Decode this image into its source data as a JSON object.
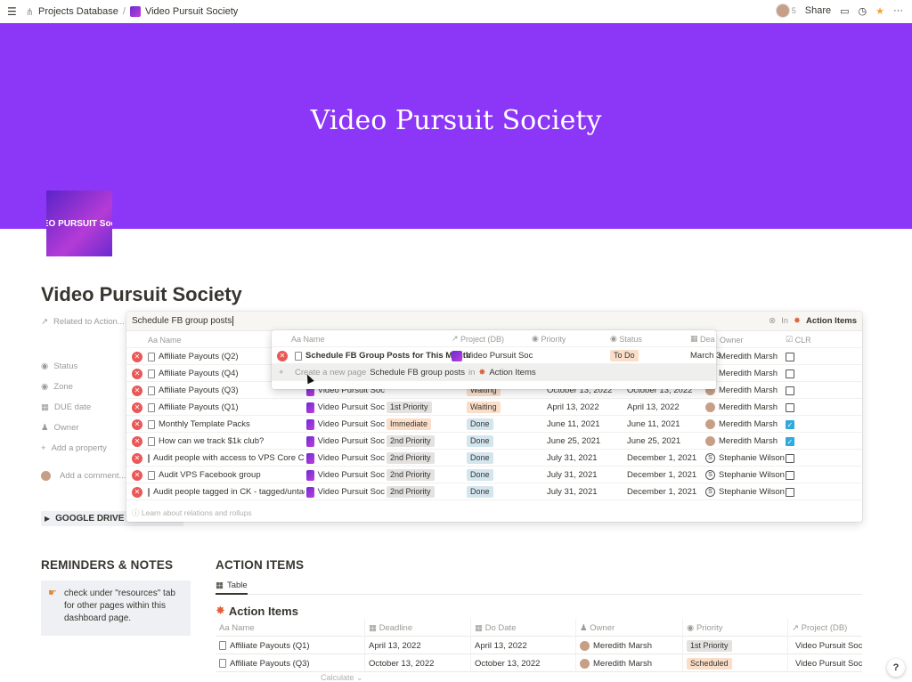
{
  "topbar": {
    "breadcrumb_parent": "Projects Database",
    "breadcrumb_sep": "/",
    "breadcrumb_current": "Video Pursuit Society",
    "share": "Share",
    "avatar_count": "5"
  },
  "cover": {
    "title": "Video Pursuit Society"
  },
  "logo": {
    "text": "EO PURSUIT Soc"
  },
  "page": {
    "title": "Video Pursuit Society"
  },
  "properties": [
    {
      "label": "Related to Action..."
    },
    {
      "label": "Status"
    },
    {
      "label": "Zone"
    },
    {
      "label": "DUE date"
    },
    {
      "label": "Owner"
    },
    {
      "label": "Add a property"
    },
    {
      "label": "Add a comment..."
    }
  ],
  "google_drive": "GOOGLE DRIVE",
  "relation": {
    "search_value": "Schedule FB group posts",
    "in_label": "In",
    "in_db": "Action Items",
    "headers": {
      "name": "Name",
      "project": "Project (DB)",
      "priority": "Priority",
      "status": "Status",
      "deadline": "Dea",
      "owner": "Owner",
      "clr": "CLR"
    },
    "footer": "Learn about relations and rollups",
    "rows": [
      {
        "name": "Affiliate Payouts (Q2)",
        "project": "Video Pursuit Soc",
        "priority": "",
        "status": "",
        "deadline": "",
        "do_date": "",
        "owner": "Meredith Marsh",
        "clr": false
      },
      {
        "name": "Affiliate Payouts (Q4)",
        "project": "Video Pursuit Soc",
        "priority": "",
        "status": "",
        "deadline": "",
        "do_date": "",
        "owner": "Meredith Marsh",
        "clr": false
      },
      {
        "name": "Affiliate Payouts (Q3)",
        "project": "Video Pursuit Soc",
        "priority": "",
        "status": "Waiting",
        "deadline": "October 13, 2022",
        "do_date": "October 13, 2022",
        "owner": "Meredith Marsh",
        "clr": false
      },
      {
        "name": "Affiliate Payouts (Q1)",
        "project": "Video Pursuit Soc",
        "priority": "1st Priority",
        "status": "Waiting",
        "deadline": "April 13, 2022",
        "do_date": "April 13, 2022",
        "owner": "Meredith Marsh",
        "clr": false
      },
      {
        "name": "Monthly Template Packs",
        "project": "Video Pursuit Soc",
        "priority": "Immediate",
        "status": "Done",
        "deadline": "June 11, 2021",
        "do_date": "June 11, 2021",
        "owner": "Meredith Marsh",
        "clr": true
      },
      {
        "name": "How can we track $1k club?",
        "project": "Video Pursuit Soc",
        "priority": "2nd Priority",
        "status": "Done",
        "deadline": "June 25, 2021",
        "do_date": "June 25, 2021",
        "owner": "Meredith Marsh",
        "clr": true
      },
      {
        "name": "Audit people with access to VPS Core Conte",
        "project": "Video Pursuit Soc",
        "priority": "2nd Priority",
        "status": "Done",
        "deadline": "July 31, 2021",
        "do_date": "December 1, 2021",
        "owner": "Stephanie Wilson",
        "clr": false
      },
      {
        "name": "Audit VPS Facebook group",
        "project": "Video Pursuit Soc",
        "priority": "2nd Priority",
        "status": "Done",
        "deadline": "July 31, 2021",
        "do_date": "December 1, 2021",
        "owner": "Stephanie Wilson",
        "clr": false
      },
      {
        "name": "Audit people tagged in CK - tagged/untagge",
        "project": "Video Pursuit Soc",
        "priority": "2nd Priority",
        "status": "Done",
        "deadline": "July 31, 2021",
        "do_date": "December 1, 2021",
        "owner": "Stephanie Wilson",
        "clr": false
      }
    ]
  },
  "popup": {
    "headers": {
      "name": "Name",
      "project": "Project (DB)",
      "priority": "Priority",
      "status": "Status",
      "deadline": "Dea"
    },
    "result": {
      "name": "Schedule FB Group Posts for This Month",
      "project": "Video Pursuit Soc",
      "status": "To Do",
      "deadline": "March 3"
    },
    "create_prefix": "Create a new page",
    "create_value": "Schedule FB group posts",
    "create_in": "in",
    "create_db": "Action Items"
  },
  "reminders": {
    "title": "REMINDERS & NOTES",
    "text": "check under \"resources\" tab for other pages within this dashboard page."
  },
  "action_items": {
    "title": "ACTION ITEMS",
    "tab": "Table",
    "db_title": "Action Items",
    "headers": {
      "name": "Name",
      "deadline": "Deadline",
      "do_date": "Do Date",
      "owner": "Owner",
      "priority": "Priority",
      "project": "Project (DB)"
    },
    "rows": [
      {
        "name": "Affiliate Payouts (Q1)",
        "deadline": "April 13, 2022",
        "do_date": "April 13, 2022",
        "owner": "Meredith Marsh",
        "priority": "1st Priority",
        "project": "Video Pursuit Soc"
      },
      {
        "name": "Affiliate Payouts (Q3)",
        "deadline": "October 13, 2022",
        "do_date": "October 13, 2022",
        "owner": "Meredith Marsh",
        "priority": "Scheduled",
        "project": "Video Pursuit Soc"
      }
    ],
    "calculate": "Calculate"
  },
  "help": "?"
}
